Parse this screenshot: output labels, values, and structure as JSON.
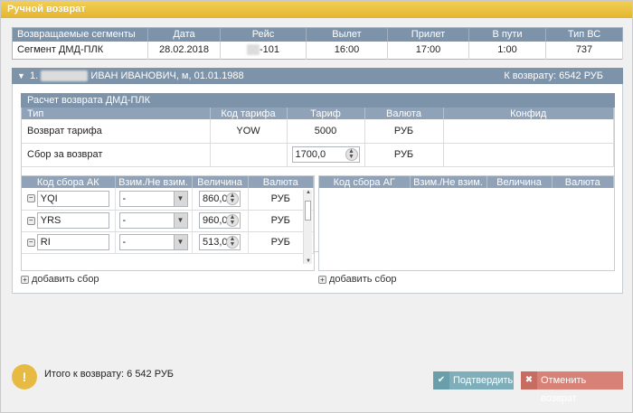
{
  "window": {
    "title": "Ручной возврат"
  },
  "segments": {
    "headers": [
      "Возвращаемые сегменты",
      "Дата",
      "Рейс",
      "Вылет",
      "Прилет",
      "В пути",
      "Тип ВС"
    ],
    "row": {
      "segment": "Сегмент ДМД-ПЛК",
      "date": "28.02.2018",
      "flight": "-101",
      "dep": "16:00",
      "arr": "17:00",
      "duration": "1:00",
      "aircraft": "737"
    }
  },
  "passenger": {
    "prefix": "1.",
    "name": "ИВАН ИВАНОВИЧ, м, 01.01.1988",
    "refund_label": "К возврату: 6542 РУБ"
  },
  "calc": {
    "title": "Расчет возврата ДМД-ПЛК",
    "headers": [
      "Тип",
      "Код тарифа",
      "Тариф",
      "Валюта",
      "Конфид"
    ],
    "rows": [
      {
        "type": "Возврат тарифа",
        "code": "YOW",
        "tariff": "5000",
        "currency": "РУБ",
        "conf": ""
      },
      {
        "type": "Сбор за возврат",
        "code": "",
        "tariff": "1700,0",
        "currency": "РУБ",
        "conf": ""
      }
    ]
  },
  "ak_fees": {
    "headers": [
      "Код сбора АК",
      "Взим./Не взим.",
      "Величина",
      "Валюта"
    ],
    "rows": [
      {
        "code": "YQI",
        "charge": "-",
        "amount": "860,0",
        "currency": "РУБ"
      },
      {
        "code": "YRS",
        "charge": "-",
        "amount": "960,0",
        "currency": "РУБ"
      },
      {
        "code": "RI",
        "charge": "-",
        "amount": "513,0",
        "currency": "РУБ"
      }
    ],
    "add_label": "добавить сбор"
  },
  "ag_fees": {
    "headers": [
      "Код сбора АГ",
      "Взим./Не взим.",
      "Величина",
      "Валюта"
    ],
    "add_label": "добавить сбор"
  },
  "footer": {
    "total_label": "Итого к возврату:",
    "total_value": "6 542 РУБ",
    "confirm_label": "Подтвердить",
    "cancel_label": "Отменить возврат"
  },
  "colors": {
    "title_bar": "#e3b62f",
    "header_blue": "#7d93aa",
    "confirm": "#7faebb",
    "cancel": "#d88277",
    "warning": "#e7bb43"
  },
  "icons": {
    "warning": "exclamation-icon",
    "confirm": "check-icon",
    "cancel": "x-icon",
    "collapse": "triangle-down-icon"
  }
}
